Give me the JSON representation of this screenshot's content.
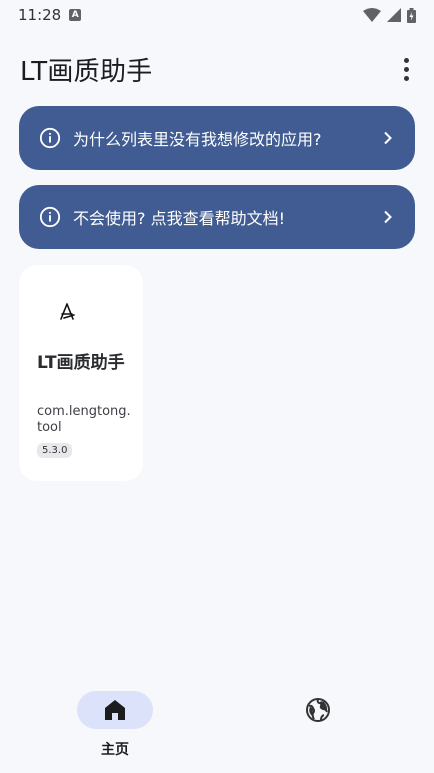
{
  "status_bar": {
    "time": "11:28"
  },
  "app_bar": {
    "title": "LT画质助手"
  },
  "banners": [
    {
      "text": "为什么列表里没有我想修改的应用?"
    },
    {
      "text": "不会使用? 点我查看帮助文档!"
    }
  ],
  "app_card": {
    "name": "LT画质助手",
    "package": "com.lengtong.tool",
    "version": "5.3.0"
  },
  "bottom_nav": {
    "home_label": "主页"
  },
  "colors": {
    "banner_bg": "#405c92",
    "nav_active_bg": "#dbe2f9",
    "background": "#f7f8fb"
  }
}
